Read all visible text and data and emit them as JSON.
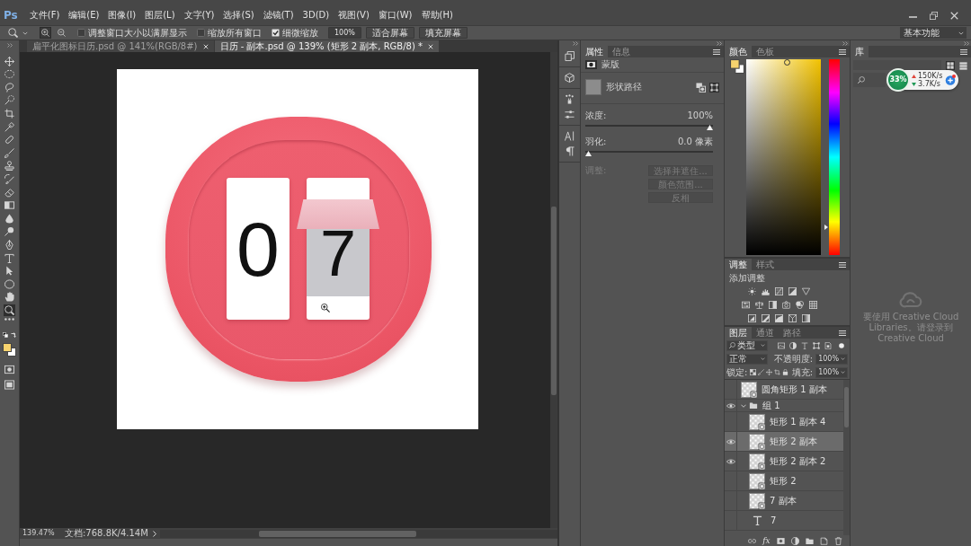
{
  "app": {
    "logo": "Ps"
  },
  "menu": [
    "文件(F)",
    "编辑(E)",
    "图像(I)",
    "图层(L)",
    "文字(Y)",
    "选择(S)",
    "滤镜(T)",
    "3D(D)",
    "视图(V)",
    "窗口(W)",
    "帮助(H)"
  ],
  "options_bar": {
    "zoom_modes": [
      {
        "kind": "zoom-in",
        "selected": true
      },
      {
        "kind": "zoom-out",
        "selected": false
      }
    ],
    "checkboxes": [
      {
        "label": "调整窗口大小以满屏显示",
        "checked": false
      },
      {
        "label": "缩放所有窗口",
        "checked": false
      },
      {
        "label": "细微缩放",
        "checked": true
      }
    ],
    "buttons": [
      {
        "kind": "zoom",
        "label": "100%"
      },
      {
        "kind": "fit",
        "label": "适合屏幕"
      },
      {
        "kind": "fill",
        "label": "填充屏幕"
      }
    ],
    "workspace": "基本功能"
  },
  "document_tabs": [
    {
      "title": "扁平化图标日历.psd @ 141%(RGB/8#)",
      "selected": false
    },
    {
      "title": "日历 - 副本.psd @ 139% (矩形 2 副本, RGB/8) *",
      "selected": true
    }
  ],
  "tools": [
    {
      "kind": "move",
      "selected": false
    },
    {
      "kind": "marquee",
      "selected": false
    },
    {
      "kind": "lasso",
      "selected": false
    },
    {
      "kind": "quick-select",
      "selected": false
    },
    {
      "kind": "crop",
      "selected": false
    },
    {
      "kind": "eyedropper",
      "selected": false
    },
    {
      "kind": "healing",
      "selected": false
    },
    {
      "kind": "brush",
      "selected": false
    },
    {
      "kind": "stamp",
      "selected": false
    },
    {
      "kind": "history-brush",
      "selected": false
    },
    {
      "kind": "eraser",
      "selected": false
    },
    {
      "kind": "gradient",
      "selected": false
    },
    {
      "kind": "blur",
      "selected": false
    },
    {
      "kind": "dodge",
      "selected": false
    },
    {
      "kind": "pen",
      "selected": false
    },
    {
      "kind": "type",
      "selected": false
    },
    {
      "kind": "path-select",
      "selected": false
    },
    {
      "kind": "shape",
      "selected": false
    },
    {
      "kind": "hand",
      "selected": false
    },
    {
      "kind": "zoom",
      "selected": true
    },
    {
      "kind": "more",
      "selected": false
    }
  ],
  "canvas": {
    "cards": [
      {
        "digit": "0",
        "flipping": false
      },
      {
        "digit": "7",
        "flipping": true
      }
    ]
  },
  "status_bar": {
    "zoom": "139.47%",
    "document": "文档:768.8K/4.14M"
  },
  "properties_panel": {
    "tabs": [
      {
        "label": "属性",
        "selected": true
      },
      {
        "label": "信息",
        "selected": false
      }
    ],
    "section": "蒙版",
    "shape": "形状路径",
    "sliders": [
      {
        "label": "浓度:",
        "reading": "100%",
        "level": 1
      },
      {
        "label": "羽化:",
        "reading": "0.0 像素",
        "level": 0
      }
    ],
    "adjust_label": "调整:",
    "buttons": [
      {
        "label": "选择并遮住...",
        "disabled": true
      },
      {
        "label": "颜色范围...",
        "disabled": true
      },
      {
        "label": "反相",
        "disabled": true
      }
    ]
  },
  "color_panel": {
    "tabs": [
      {
        "label": "颜色",
        "selected": true
      },
      {
        "label": "色板",
        "selected": false
      }
    ],
    "hue_slider": {
      "level": 0.14
    }
  },
  "adjustments_panel": {
    "tabs": [
      {
        "label": "调整",
        "selected": true
      },
      {
        "label": "样式",
        "selected": false
      }
    ],
    "heading": "添加调整"
  },
  "layers_panel": {
    "tabs": [
      {
        "label": "图层",
        "selected": true
      },
      {
        "label": "通道",
        "selected": false
      },
      {
        "label": "路径",
        "selected": false
      }
    ],
    "filter": "类型",
    "blend_mode": "正常",
    "opacity_label": "不透明度:",
    "opacity": "100%",
    "lock_label": "锁定:",
    "fill_label": "填充:",
    "fill": "100%",
    "layers": [
      {
        "name": "圆角矩形 1 副本",
        "kind": "shape",
        "visible": false,
        "selected": false
      },
      {
        "name": "组 1",
        "kind": "group",
        "visible": true,
        "selected": false,
        "expanded": true,
        "children": [
          {
            "name": "矩形 1 副本 4",
            "kind": "shape",
            "visible": false,
            "selected": false
          },
          {
            "name": "矩形 2 副本",
            "kind": "shape",
            "visible": true,
            "selected": true
          },
          {
            "name": "矩形 2 副本 2",
            "kind": "shape",
            "visible": true,
            "selected": false
          },
          {
            "name": "矩形 2",
            "kind": "shape",
            "visible": false,
            "selected": false
          },
          {
            "name": "7 副本",
            "kind": "shape",
            "visible": false,
            "selected": false
          },
          {
            "name": "7",
            "kind": "text",
            "visible": false,
            "selected": false
          }
        ]
      }
    ],
    "effects_button": "fx"
  },
  "library_panel": {
    "tabs": [
      {
        "label": "库",
        "selected": true
      }
    ],
    "message": "要使用 Creative Cloud Libraries。请登录到 Creative Cloud"
  },
  "speed_widget": {
    "percent": "33%",
    "upload": "150K/s",
    "download": "3.7K/s"
  }
}
